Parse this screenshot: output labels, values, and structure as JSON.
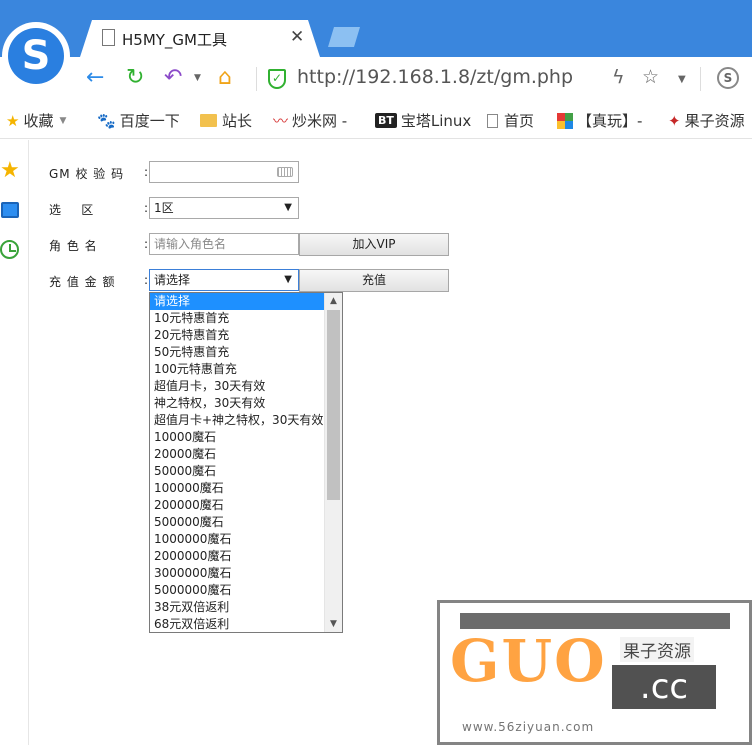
{
  "browser": {
    "tab_title": "H5MY_GM工具",
    "url": "http://192.168.1.8/zt/gm.php"
  },
  "bookmarks": [
    {
      "label": "收藏"
    },
    {
      "label": "百度一下"
    },
    {
      "label": "站长"
    },
    {
      "label": "炒米网 -"
    },
    {
      "label": "宝塔Linux",
      "badge": "BT"
    },
    {
      "label": "首页"
    },
    {
      "label": "【真玩】-"
    },
    {
      "label": "果子资源"
    }
  ],
  "form": {
    "gm_label": "GM 校 验 码",
    "zone_label": "选    区",
    "zone_value": "1区",
    "role_label": "角 色 名",
    "role_placeholder": "请输入角色名",
    "vip_button": "加入VIP",
    "amount_label": "充 值 金 额",
    "amount_value": "请选择",
    "recharge_button": "充值",
    "colon": ":"
  },
  "dropdown_options": [
    "请选择",
    "10元特惠首充",
    "20元特惠首充",
    "50元特惠首充",
    "100元特惠首充",
    "超值月卡，30天有效",
    "神之特权，30天有效",
    "超值月卡+神之特权，30天有效",
    "10000魔石",
    "20000魔石",
    "50000魔石",
    "100000魔石",
    "200000魔石",
    "500000魔石",
    "1000000魔石",
    "2000000魔石",
    "3000000魔石",
    "5000000魔石",
    "38元双倍返利",
    "68元双倍返利"
  ],
  "watermark": {
    "brand": "GUO",
    "cn": "果子资源",
    "cc": ".cc",
    "url": "www.56ziyuan.com"
  },
  "colors": {
    "tabstrip": "#3a86dd",
    "selected_option": "#1e90ff"
  }
}
